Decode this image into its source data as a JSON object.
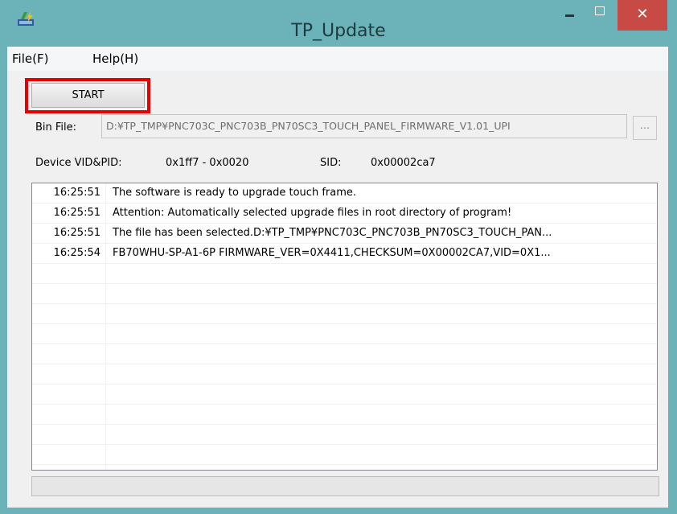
{
  "window": {
    "title": "TP_Update",
    "close_glyph": "✕"
  },
  "menu": {
    "items": [
      {
        "label": "File(F)"
      },
      {
        "label": "Help(H)"
      }
    ]
  },
  "toolbar": {
    "start_label": "START",
    "highlight_color": "#e60000"
  },
  "bin_file": {
    "label": "Bin File:",
    "value": "D:¥TP_TMP¥PNC703C_PNC703B_PN70SC3_TOUCH_PANEL_FIRMWARE_V1.01_UPI",
    "browse_label": "..."
  },
  "device": {
    "vidpid_label": "Device VID&PID:",
    "vidpid_value": "0x1ff7 - 0x0020",
    "sid_label": "SID:",
    "sid_value": "0x00002ca7"
  },
  "log": {
    "entries": [
      {
        "time": "16:25:51",
        "message": "The software is ready to upgrade touch frame."
      },
      {
        "time": "16:25:51",
        "message": "Attention: Automatically selected upgrade files in root directory of program!"
      },
      {
        "time": "16:25:51",
        "message": "The file has been selected.D:¥TP_TMP¥PNC703C_PNC703B_PN70SC3_TOUCH_PAN..."
      },
      {
        "time": "16:25:54",
        "message": "FB70WHU-SP-A1-6P FIRMWARE_VER=0X4411,CHECKSUM=0X00002CA7,VID=0X1..."
      }
    ]
  },
  "progress": {
    "value": 0
  },
  "icons": {
    "app": "app-icon",
    "minimize": "minimize-icon",
    "maximize": "maximize-icon",
    "close": "close-icon"
  },
  "colors": {
    "titlebar": "#6bb3b9",
    "close_button": "#c74a44",
    "client": "#f0f0f0"
  }
}
